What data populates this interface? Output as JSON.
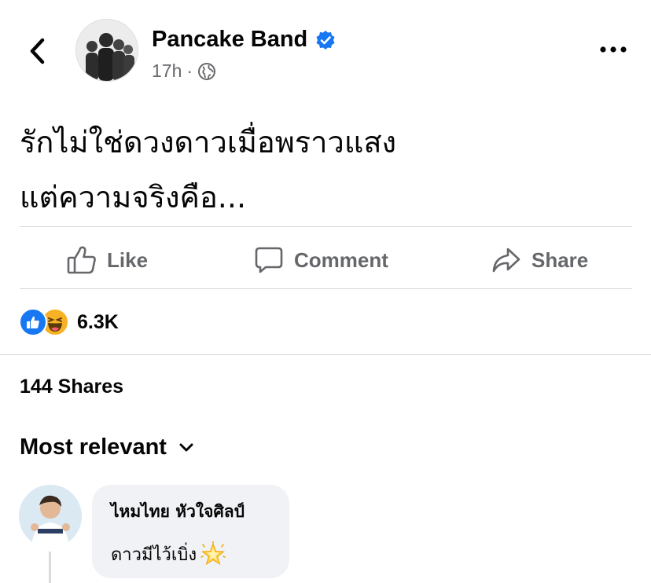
{
  "header": {
    "page_name": "Pancake Band",
    "time": "17h",
    "separator": "·",
    "verified": true,
    "audience_icon": "globe-icon"
  },
  "post": {
    "lines": [
      "รักไม่ใช่ดวงดาวเมื่อพราวแสง",
      "แต่ความจริงคือ..."
    ]
  },
  "actions": {
    "like": "Like",
    "comment": "Comment",
    "share": "Share"
  },
  "stats": {
    "reactions": [
      "like",
      "haha"
    ],
    "reaction_count": "6.3K",
    "shares": "144 Shares"
  },
  "comments": {
    "sort_label": "Most relevant",
    "items": [
      {
        "author": "ไหมไทย หัวใจศิลป์",
        "text": "ดาวมีไว้เบิ่ง",
        "emoji": "glowing-star"
      }
    ]
  },
  "colors": {
    "brand_blue": "#1877f2",
    "secondary_text": "#65676b",
    "bubble_bg": "#f0f2f5",
    "haha_yellow": "#f7b125"
  }
}
